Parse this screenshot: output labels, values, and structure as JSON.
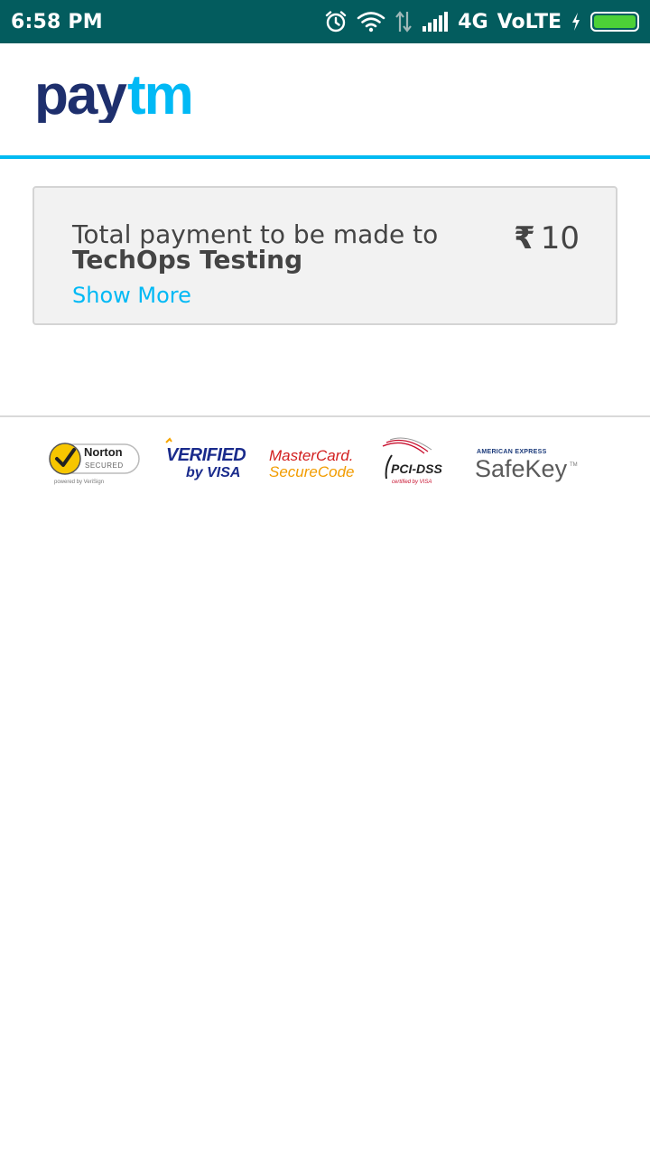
{
  "status_bar": {
    "time": "6:58 PM",
    "network": "4G",
    "volte": "VoLTE"
  },
  "header": {
    "logo": {
      "text_pay": "pay",
      "text_tm": "tm",
      "color_pay": "#1e2f6d",
      "color_tm": "#00b9f5"
    },
    "accent_color": "#00baf2"
  },
  "payment": {
    "label": "Total payment to be made to",
    "merchant": "TechOps Testing",
    "currency_symbol": "₹",
    "amount": "10",
    "show_more": "Show More"
  },
  "badges": {
    "norton": {
      "line1": "Norton",
      "line2": "SECURED",
      "line3": "powered by VeriSign"
    },
    "visa": {
      "line1": "VERIFIED",
      "line2": "by VISA"
    },
    "mastercard": {
      "line1": "MasterCard.",
      "line2": "SecureCode"
    },
    "pci": {
      "line1": "PCI-DSS",
      "line2": "certified by VISA"
    },
    "amex": {
      "line1": "AMERICAN EXPRESS",
      "line2": "SafeKey",
      "tm": "TM"
    }
  }
}
